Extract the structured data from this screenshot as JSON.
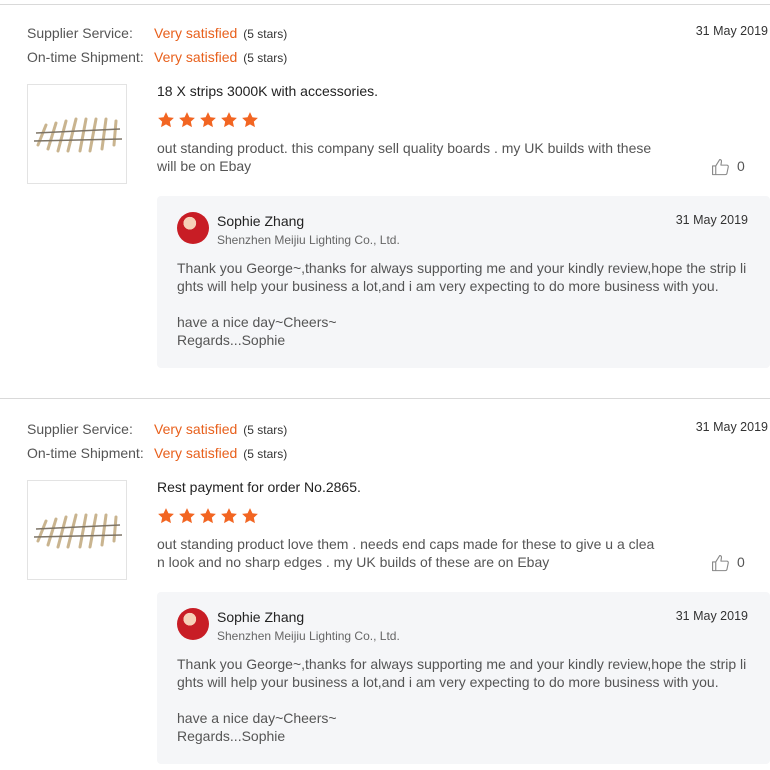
{
  "reviews": [
    {
      "supplier_service_label": "Supplier Service:",
      "supplier_service_value": "Very satisfied",
      "supplier_service_stars": "(5 stars)",
      "shipment_label": "On-time Shipment:",
      "shipment_value": "Very satisfied",
      "shipment_stars": "(5 stars)",
      "date": "31 May 2019",
      "product_title": "18 X strips 3000K with accessories.",
      "rating": 5,
      "text": "out standing product. this company sell quality boards .  my UK builds with these will be on Ebay",
      "likes": "0",
      "reply": {
        "name": "Sophie Zhang",
        "company": "Shenzhen Meijiu Lighting Co., Ltd.",
        "date": "31 May 2019",
        "line1": "Thank you George~,thanks for always supporting me and your kindly review,hope the strip lights will help your business a lot,and i am very expecting to do more business with you.",
        "line2": "have a nice day~Cheers~",
        "line3": "Regards...Sophie"
      }
    },
    {
      "supplier_service_label": "Supplier Service:",
      "supplier_service_value": "Very satisfied",
      "supplier_service_stars": "(5 stars)",
      "shipment_label": "On-time Shipment:",
      "shipment_value": "Very satisfied",
      "shipment_stars": "(5 stars)",
      "date": "31 May 2019",
      "product_title": "Rest payment for order No.2865.",
      "rating": 5,
      "text": "out standing product love them  . needs end caps made for these   to give u a clean look and no sharp edges .  my UK builds of these are on Ebay",
      "likes": "0",
      "reply": {
        "name": "Sophie Zhang",
        "company": "Shenzhen Meijiu Lighting Co., Ltd.",
        "date": "31 May 2019",
        "line1": "Thank you George~,thanks for always supporting me and your kindly review,hope the strip lights will help your business a lot,and i am very expecting to do more business with you.",
        "line2": "have a nice day~Cheers~",
        "line3": "Regards...Sophie"
      }
    }
  ],
  "colors": {
    "accent": "#e8601c",
    "star": "#f26522",
    "reply_bg": "#f5f6f8"
  },
  "icons": {
    "like": "thumbs-up-icon",
    "star": "star-icon"
  }
}
